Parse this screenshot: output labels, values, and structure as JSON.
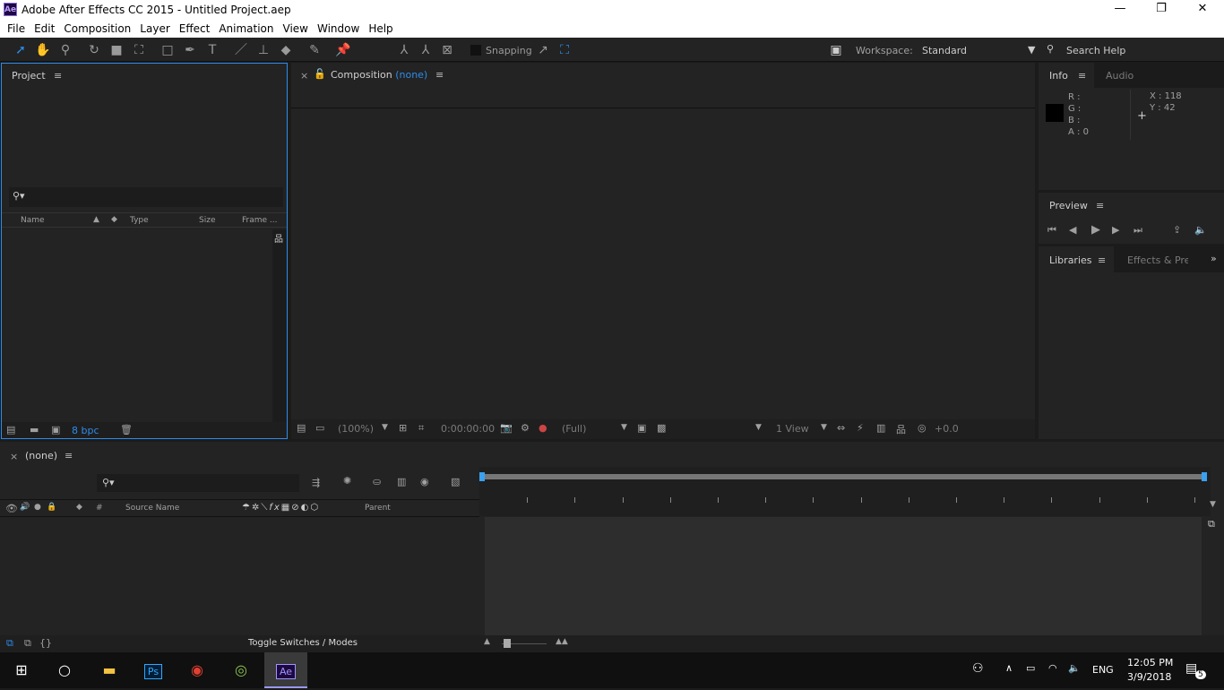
{
  "window": {
    "title": "Adobe After Effects CC 2015 - Untitled Project.aep",
    "logo": "Ae"
  },
  "menu": [
    "File",
    "Edit",
    "Composition",
    "Layer",
    "Effect",
    "Animation",
    "View",
    "Window",
    "Help"
  ],
  "toolbar": {
    "snapping": "Snapping",
    "workspace_label": "Workspace:",
    "workspace": "Standard",
    "search_placeholder": "Search Help"
  },
  "project": {
    "title": "Project",
    "columns": [
      "Name",
      "Type",
      "Size",
      "Frame ..."
    ],
    "bpc": "8 bpc"
  },
  "composition": {
    "title": "Composition",
    "name": "(none)",
    "zoom": "(100%)",
    "timecode": "0:00:00:00",
    "resolution": "(Full)",
    "views": "1 View",
    "exposure": "+0.0"
  },
  "info": {
    "tabs": [
      "Info",
      "Audio"
    ],
    "r": "R :",
    "g": "G :",
    "b": "B :",
    "a": "A : 0",
    "x": "X : 118",
    "y": "Y : 42"
  },
  "preview": {
    "title": "Preview"
  },
  "libraries": {
    "tabs": [
      "Libraries",
      "Effects & Pres"
    ]
  },
  "timeline": {
    "tab": "(none)",
    "columns": [
      "#",
      "Source Name",
      "Parent"
    ],
    "toggle": "Toggle Switches / Modes"
  },
  "taskbar": {
    "lang": "ENG",
    "time": "12:05 PM",
    "date": "3/9/2018",
    "notifications": "5"
  }
}
